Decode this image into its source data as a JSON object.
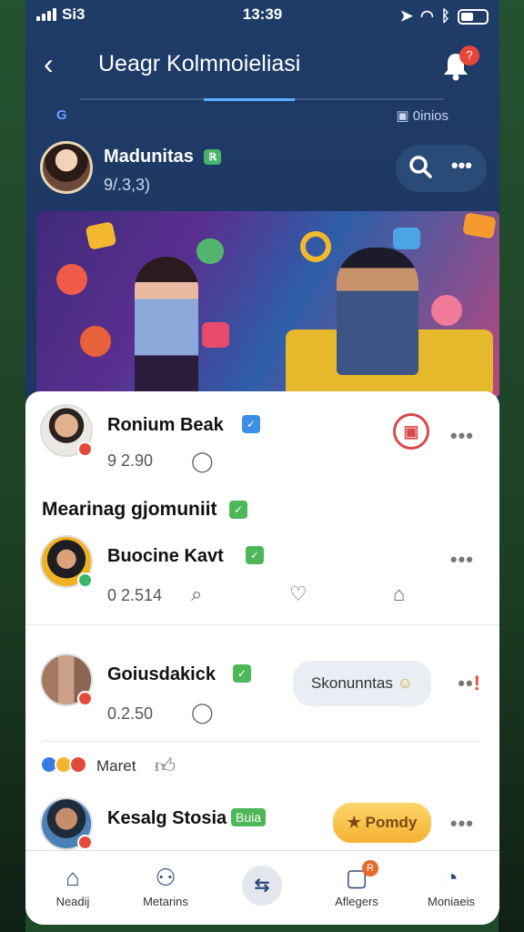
{
  "status": {
    "carrier": "Si3",
    "time": "13:39"
  },
  "header": {
    "title": "Ueagr Kolmnoieliasi",
    "notification_count": "?"
  },
  "subrow": {
    "left": "",
    "right": "0inios"
  },
  "profile": {
    "name": "Madunitas",
    "verified": "ℝ",
    "number": "9/.3,3)"
  },
  "feed": [
    {
      "name": "Ronium Beak",
      "meta": "9 2.90"
    },
    {
      "name": "Buocine Kavt",
      "meta": "0 2.514"
    },
    {
      "name": "Goiusdakick",
      "meta": "0.2.50",
      "chip": "Skonunntas"
    },
    {
      "name": "Kesalg Stosia",
      "tag": "Buia",
      "chip": "Pomdy"
    }
  ],
  "section_title": "Mearinag gjomuniit",
  "reactions": {
    "label": "Maret"
  },
  "nav": [
    {
      "label": "Neadij"
    },
    {
      "label": "Metarins"
    },
    {
      "label": ""
    },
    {
      "label": "Aflegers",
      "badge": "R"
    },
    {
      "label": "Moniaeis"
    }
  ]
}
